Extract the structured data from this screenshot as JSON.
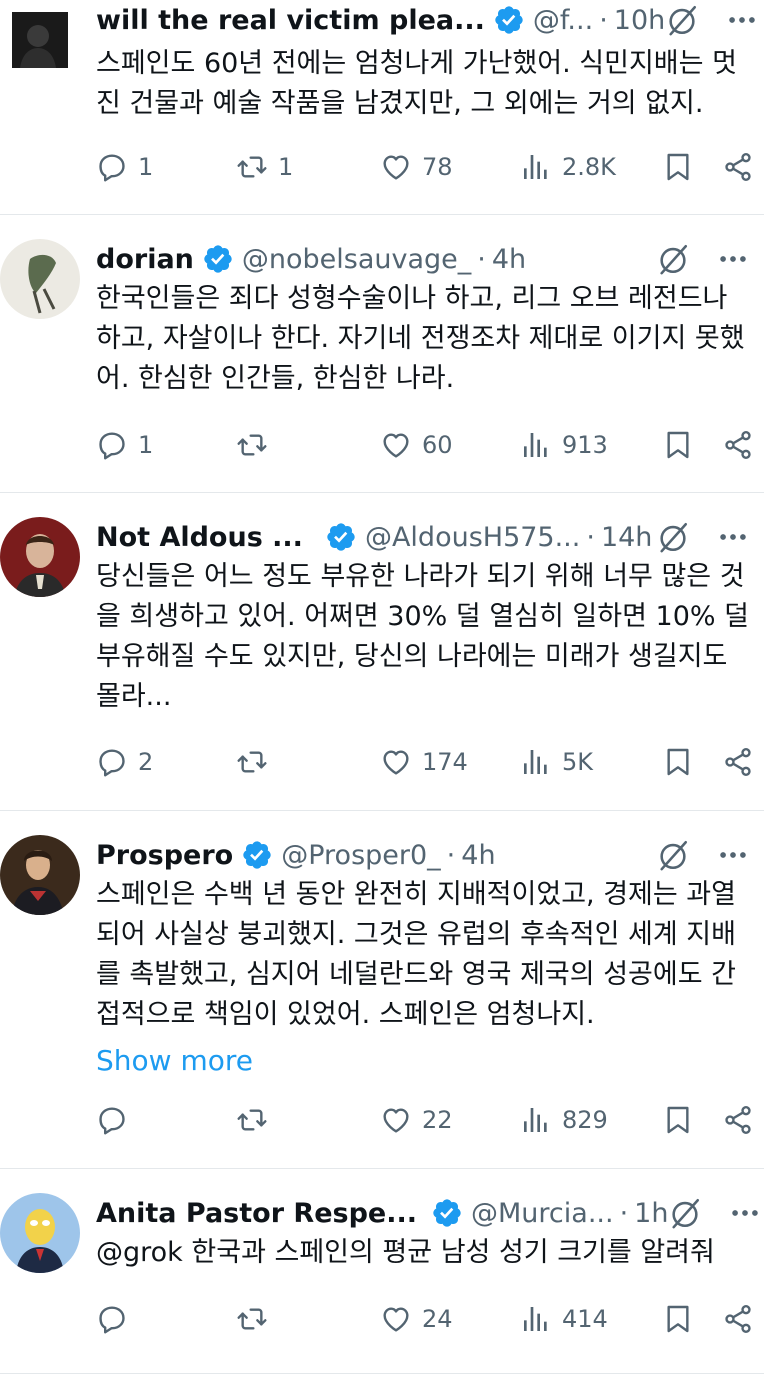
{
  "tweets": [
    {
      "name": "will the real victim plea...",
      "handle": "@f...",
      "time": "10h",
      "verified": true,
      "lines": [
        "스페인도 60년 전에는 엄청나게 가난했어. 식민지배는 멋",
        "진 건물과 예술 작품을 남겼지만, 그 외에는 거의 없지."
      ],
      "show_more": "",
      "replies": "1",
      "reposts": "1",
      "likes": "78",
      "views": "2.8K"
    },
    {
      "name": "dorian",
      "handle": "@nobelsauvage_",
      "time": "4h",
      "verified": true,
      "lines": [
        "한국인들은 죄다 성형수술이나 하고, 리그 오브 레전드나",
        "하고, 자살이나 한다. 자기네 전쟁조차 제대로 이기지 못했",
        "어. 한심한 인간들, 한심한 나라."
      ],
      "show_more": "",
      "replies": "1",
      "reposts": "",
      "likes": "60",
      "views": "913"
    },
    {
      "name": "Not Aldous ...",
      "handle": "@AldousH575...",
      "time": "14h",
      "verified": true,
      "lines": [
        "당신들은 어느 정도 부유한 나라가 되기 위해 너무 많은 것",
        "을 희생하고 있어. 어쩌면 30% 덜 열심히 일하면 10% 덜",
        "부유해질 수도 있지만, 당신의 나라에는 미래가 생길지도",
        "몰라..."
      ],
      "show_more": "",
      "replies": "2",
      "reposts": "",
      "likes": "174",
      "views": "5K"
    },
    {
      "name": "Prospero",
      "handle": "@Prosper0_",
      "time": "4h",
      "verified": true,
      "lines": [
        "스페인은 수백 년 동안 완전히 지배적이었고, 경제는 과열",
        "되어 사실상 붕괴했지. 그것은 유럽의 후속적인 세계 지배",
        "를 촉발했고, 심지어 네덜란드와 영국 제국의 성공에도 간",
        "접적으로 책임이 있었어. 스페인은 엄청나지."
      ],
      "show_more": "Show more",
      "replies": "",
      "reposts": "",
      "likes": "22",
      "views": "829"
    },
    {
      "name": "Anita Pastor Respe...",
      "handle": "@Murcia...",
      "time": "1h",
      "verified": true,
      "lines": [
        "@grok 한국과 스페인의 평균 남성 성기 크기를 알려줘"
      ],
      "show_more": "",
      "replies": "",
      "reposts": "",
      "likes": "24",
      "views": "414"
    }
  ],
  "colors": {
    "verified": "#1d9bf0",
    "muted": "#536471",
    "link": "#1d9bf0",
    "divider": "#e4e8eb"
  },
  "icons": [
    "verified-badge-icon",
    "grok-icon",
    "more-icon",
    "reply-icon",
    "repost-icon",
    "like-icon",
    "views-icon",
    "bookmark-icon",
    "share-icon"
  ]
}
